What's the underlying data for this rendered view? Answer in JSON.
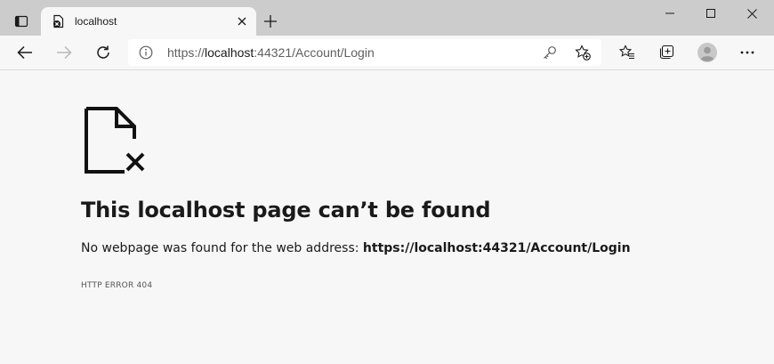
{
  "tab": {
    "title": "localhost"
  },
  "address_bar": {
    "scheme": "https://",
    "host": "localhost",
    "rest": ":44321/Account/Login"
  },
  "error_page": {
    "title": "This localhost page can’t be found",
    "description_prefix": "No webpage was found for the web address:",
    "address": "https://localhost:44321/Account/Login",
    "error_code": "HTTP ERROR 404"
  },
  "icons": {
    "tab_actions": "tab-actions-icon",
    "favicon": "page-error-icon",
    "tab_close": "close-icon",
    "new_tab": "plus-icon",
    "minimize": "minimize-icon",
    "maximize": "maximize-icon",
    "close": "close-window-icon",
    "back": "back-arrow-icon",
    "forward": "forward-arrow-icon",
    "refresh": "refresh-icon",
    "info": "info-icon",
    "key": "key-icon",
    "add_favorite": "add-favorite-icon",
    "favorites": "favorites-icon",
    "collections": "collections-icon",
    "profile": "profile-avatar-icon",
    "more": "more-icon",
    "error_document": "broken-document-icon"
  },
  "colors": {
    "titlebar": "#cccccc",
    "page_background": "#f7f7f7",
    "text": "#1a1a1a"
  }
}
